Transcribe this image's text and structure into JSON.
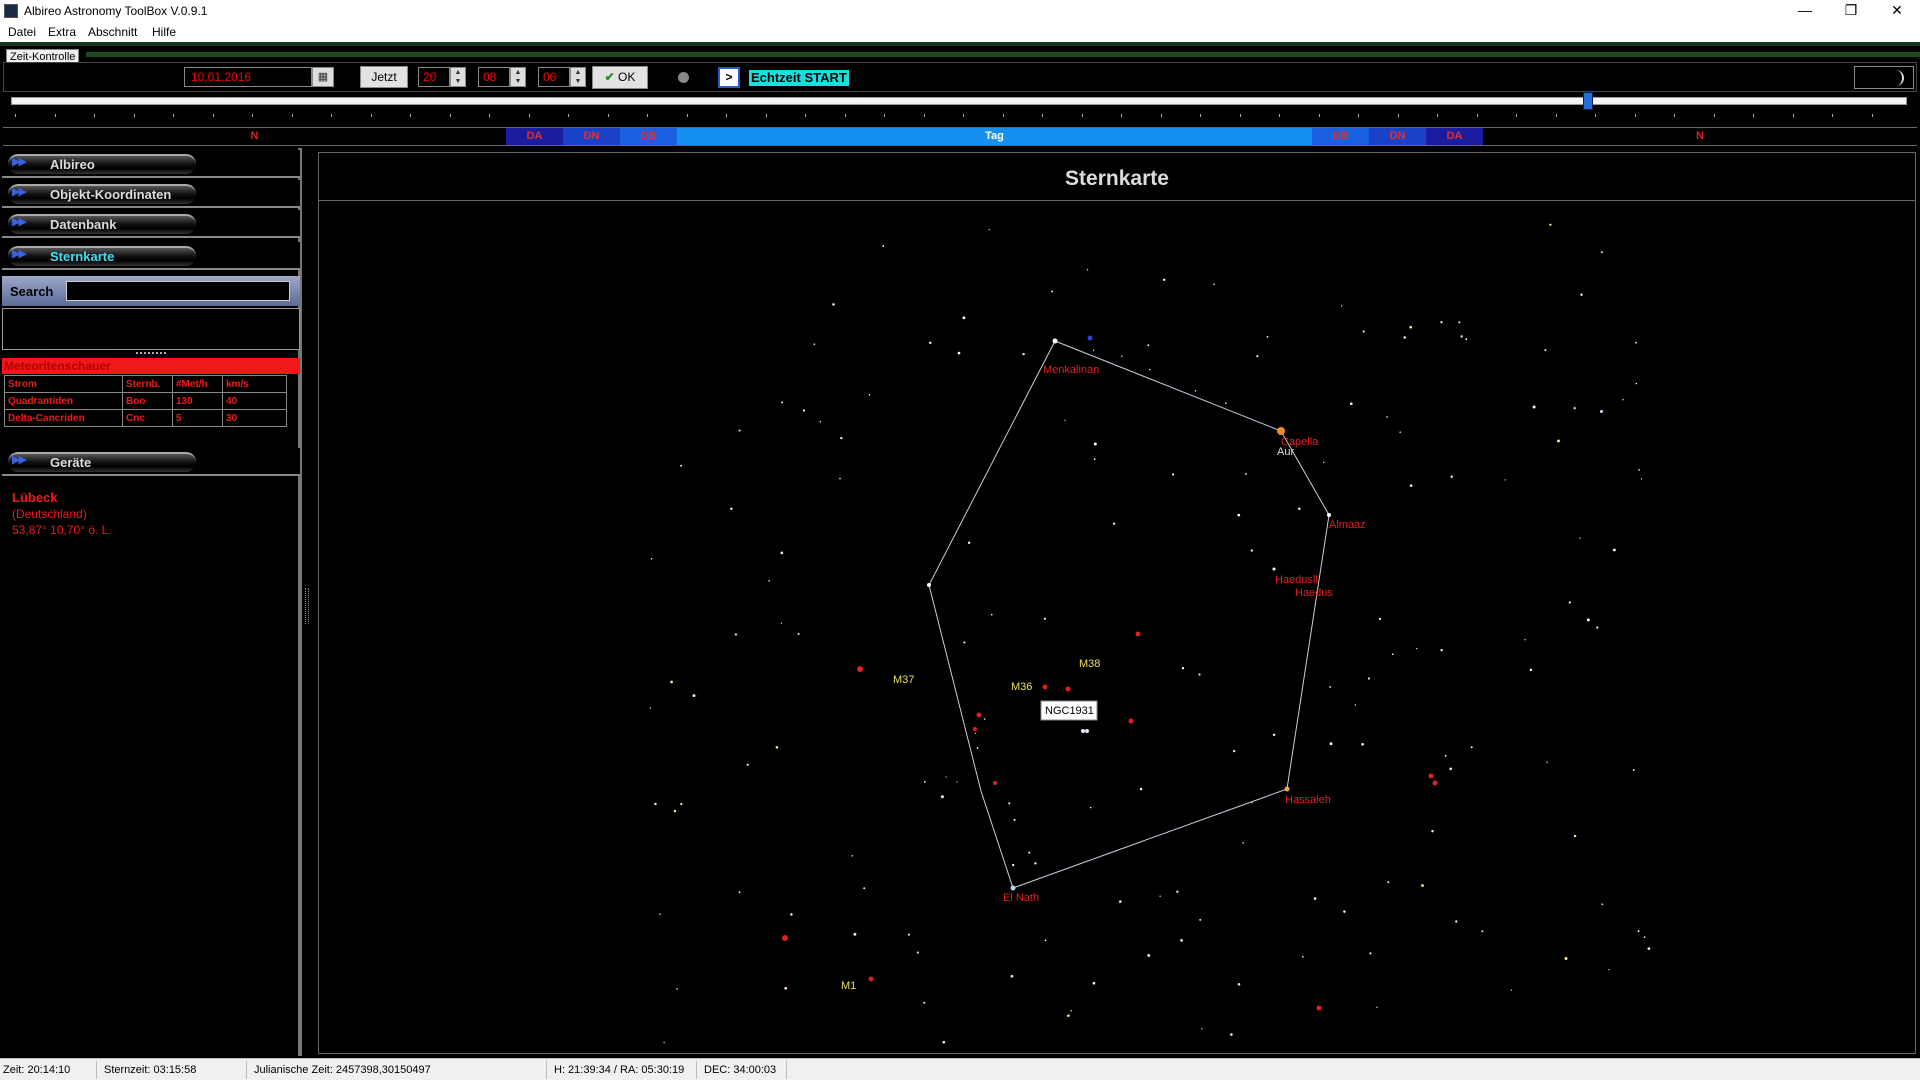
{
  "window": {
    "title": "Albireo Astronomy ToolBox V.0.9.1",
    "min_icon": "minimize-icon",
    "max_icon": "restore-icon",
    "close_icon": "close-icon"
  },
  "menu": {
    "datei": "Datei",
    "extra": "Extra",
    "abschnitt": "Abschnitt",
    "hilfe": "Hilfe"
  },
  "panel": {
    "tab": "Zeit-Kontrolle"
  },
  "toolbar": {
    "date": "10.01.2016",
    "jetzt": "Jetzt",
    "hour": "20",
    "minute": "08",
    "second": "06",
    "ok": "OK",
    "play": ">",
    "realtime": "Echtzeit START"
  },
  "slider": {
    "position": 0.832
  },
  "daybar": {
    "segments": [
      {
        "label": "N",
        "kind": "n"
      },
      {
        "label": "DA",
        "kind": "da"
      },
      {
        "label": "DN",
        "kind": "dn"
      },
      {
        "label": "DB",
        "kind": "db"
      },
      {
        "label": "Tag",
        "kind": "tag"
      },
      {
        "label": "DB",
        "kind": "db"
      },
      {
        "label": "DN",
        "kind": "dn"
      },
      {
        "label": "DA",
        "kind": "da"
      },
      {
        "label": "N",
        "kind": "n"
      }
    ]
  },
  "sidebar": {
    "nav": [
      {
        "label": "Albireo"
      },
      {
        "label": "Objekt-Koordinaten"
      },
      {
        "label": "Datenbank"
      },
      {
        "label": "Sternkarte",
        "active": true
      }
    ],
    "search_label": "Search",
    "search_value": "",
    "meteor_title": "Meteoritenschauer",
    "meteor_headers": [
      "Strom",
      "Sternb.",
      "#Met/h",
      "km/s"
    ],
    "meteor_rows": [
      [
        "Quadrantiden",
        "Boo",
        "130",
        "40"
      ],
      [
        "Delta-Cancriden",
        "Cnc",
        "5",
        "30"
      ]
    ],
    "geraete": "Geräte",
    "location": {
      "city": "Lübeck",
      "country": "(Deutschland)",
      "coords": "53,87°  10,70° ö. L."
    }
  },
  "map": {
    "title": "Sternkarte",
    "labels": [
      {
        "text": "Menkalinan",
        "color": "#e02020"
      },
      {
        "text": "Capella",
        "color": "#e02020"
      },
      {
        "text": "Aur",
        "color": "#dddddd"
      },
      {
        "text": "Almaaz",
        "color": "#e02020"
      },
      {
        "text": "Haedusll",
        "color": "#e02020"
      },
      {
        "text": "Haedus",
        "color": "#e02020"
      },
      {
        "text": "Hassaleh",
        "color": "#e02020"
      },
      {
        "text": "El Nath",
        "color": "#e02020"
      },
      {
        "text": "M37",
        "color": "#e8e060"
      },
      {
        "text": "M36",
        "color": "#e8e060"
      },
      {
        "text": "M38",
        "color": "#e8e060"
      },
      {
        "text": "M1",
        "color": "#e8e060"
      }
    ],
    "tooltip": "NGC1931"
  },
  "status": {
    "zeit": "Zeit: 20:14:10",
    "sternzeit": "Sternzeit: 03:15:58",
    "julian": "Julianische Zeit: 2457398,30150497",
    "hra": "H: 21:39:34 / RA: 05:30:19",
    "dec": "DEC: 34:00:03"
  }
}
